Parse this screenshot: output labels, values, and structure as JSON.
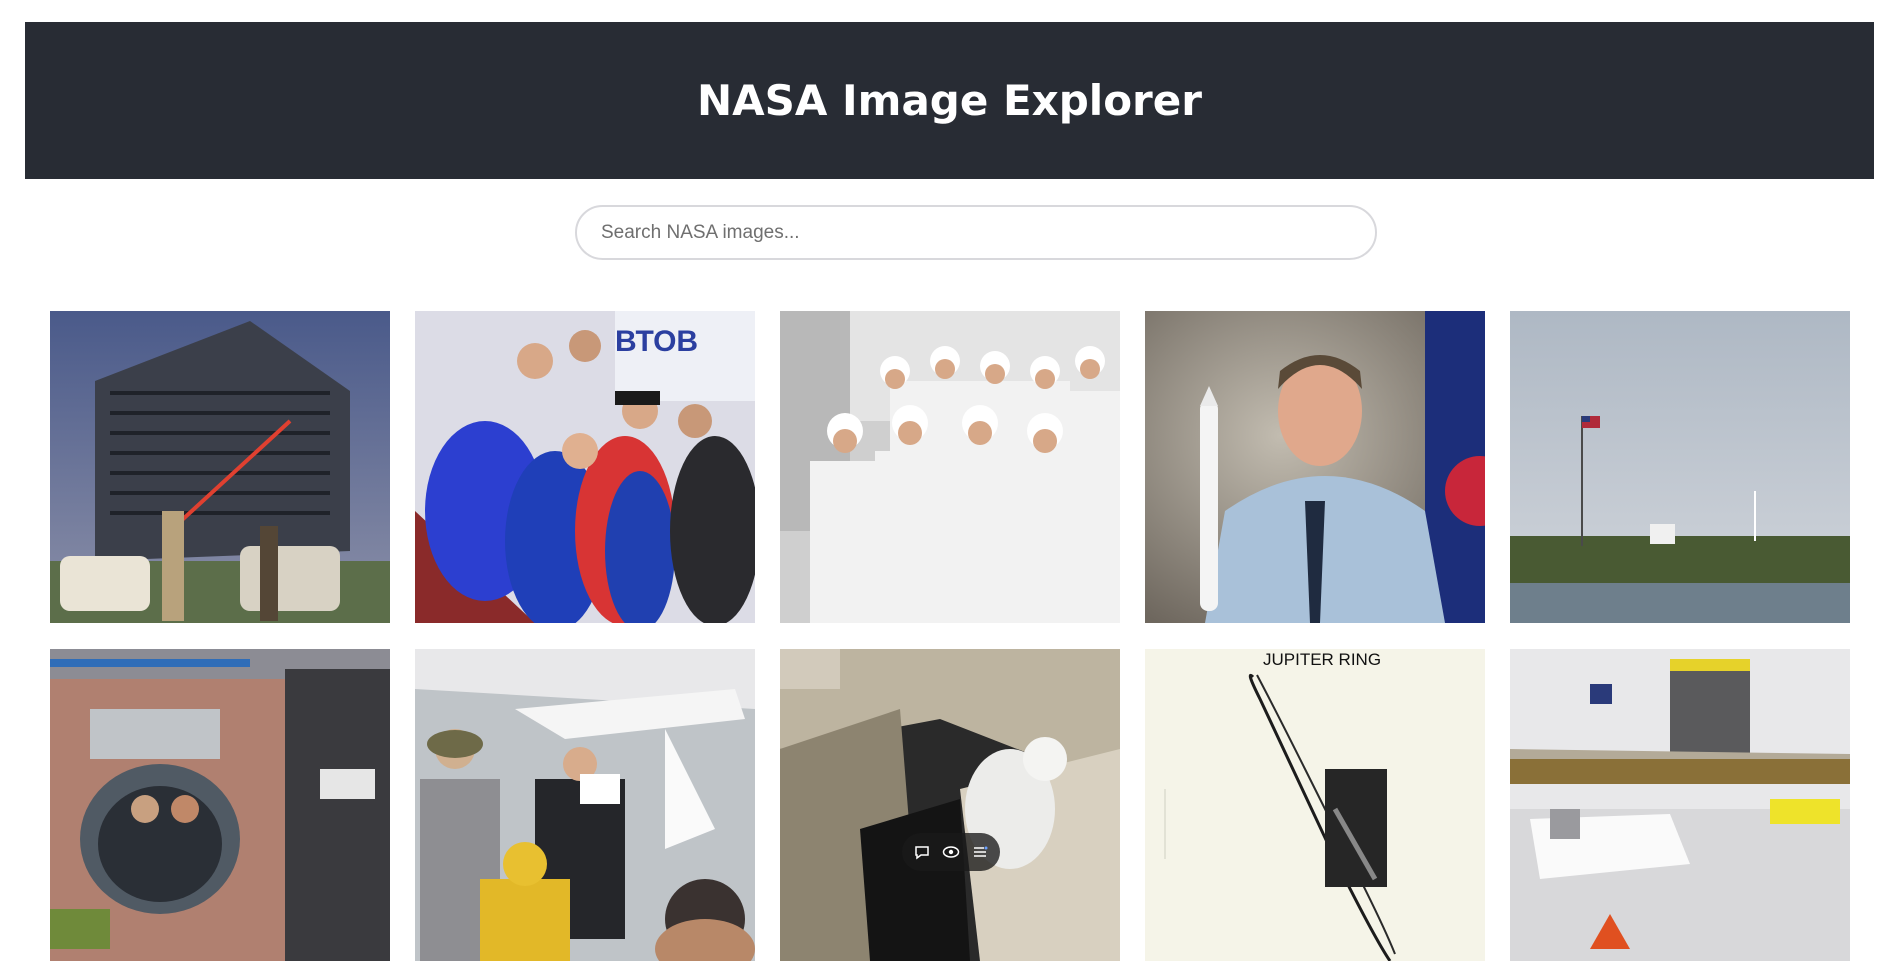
{
  "header": {
    "title": "NASA Image Explorer"
  },
  "search": {
    "placeholder": "Search NASA images...",
    "value": ""
  },
  "gallery": {
    "images": [
      {
        "name": "office-building-photo"
      },
      {
        "name": "crew-arrival-photo"
      },
      {
        "name": "cleanroom-team-photo"
      },
      {
        "name": "astronaut-portrait-photo"
      },
      {
        "name": "launch-site-flag-photo"
      },
      {
        "name": "space-station-interior-photo"
      },
      {
        "name": "aircraft-hangar-photo"
      },
      {
        "name": "spacewalk-photo"
      },
      {
        "name": "jupiter-ring-photo",
        "caption": "JUPITER RING"
      },
      {
        "name": "assembly-facility-photo"
      }
    ]
  },
  "overlay_toolbar": {
    "icons": [
      "comment-icon",
      "eye-icon",
      "list-icon"
    ]
  }
}
